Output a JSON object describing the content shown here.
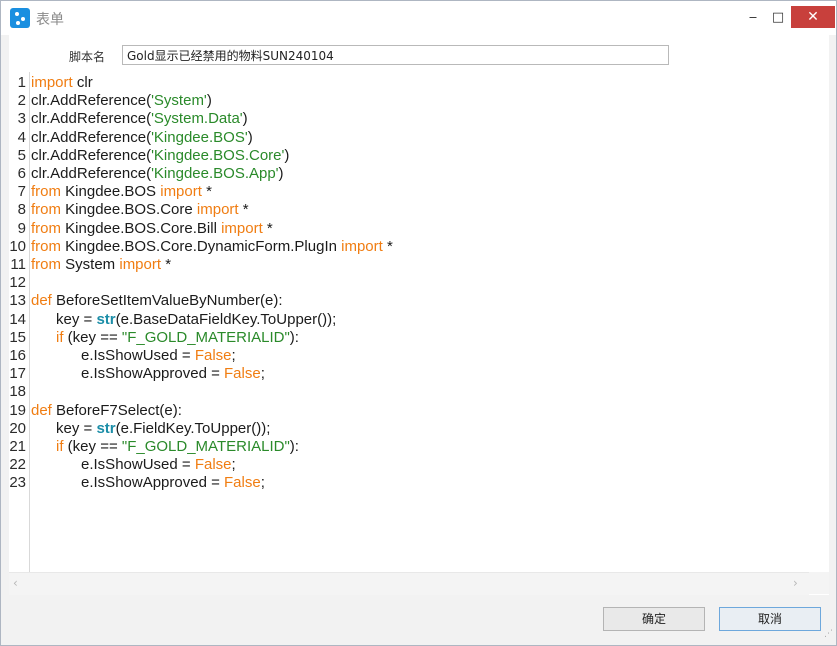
{
  "window": {
    "title": "表单",
    "minimize_icon": "minimize-icon",
    "maximize_icon": "maximize-icon",
    "close_icon": "close-icon"
  },
  "form": {
    "script_name_label": "脚本名",
    "script_name_value": "Gold显示已经禁用的物料SUN240104"
  },
  "editor": {
    "lines": [
      {
        "n": "1",
        "segs": [
          [
            "kw",
            "import"
          ],
          [
            "t",
            " clr"
          ]
        ]
      },
      {
        "n": "2",
        "segs": [
          [
            "t",
            "clr.AddReference("
          ],
          [
            "str",
            "'System'"
          ],
          [
            "t",
            ")"
          ]
        ]
      },
      {
        "n": "3",
        "segs": [
          [
            "t",
            "clr.AddReference("
          ],
          [
            "str",
            "'System.Data'"
          ],
          [
            "t",
            ")"
          ]
        ]
      },
      {
        "n": "4",
        "segs": [
          [
            "t",
            "clr.AddReference("
          ],
          [
            "str",
            "'Kingdee.BOS'"
          ],
          [
            "t",
            ")"
          ]
        ]
      },
      {
        "n": "5",
        "segs": [
          [
            "t",
            "clr.AddReference("
          ],
          [
            "str",
            "'Kingdee.BOS.Core'"
          ],
          [
            "t",
            ")"
          ]
        ]
      },
      {
        "n": "6",
        "segs": [
          [
            "t",
            "clr.AddReference("
          ],
          [
            "str",
            "'Kingdee.BOS.App'"
          ],
          [
            "t",
            ")"
          ]
        ]
      },
      {
        "n": "7",
        "segs": [
          [
            "kw",
            "from"
          ],
          [
            "t",
            " Kingdee.BOS "
          ],
          [
            "kw",
            "import"
          ],
          [
            "t",
            " *"
          ]
        ]
      },
      {
        "n": "8",
        "segs": [
          [
            "kw",
            "from"
          ],
          [
            "t",
            " Kingdee.BOS.Core "
          ],
          [
            "kw",
            "import"
          ],
          [
            "t",
            " *"
          ]
        ]
      },
      {
        "n": "9",
        "segs": [
          [
            "kw",
            "from"
          ],
          [
            "t",
            " Kingdee.BOS.Core.Bill "
          ],
          [
            "kw",
            "import"
          ],
          [
            "t",
            " *"
          ]
        ]
      },
      {
        "n": "10",
        "segs": [
          [
            "kw",
            "from"
          ],
          [
            "t",
            " Kingdee.BOS.Core.DynamicForm.PlugIn "
          ],
          [
            "kw",
            "import"
          ],
          [
            "t",
            " *"
          ]
        ]
      },
      {
        "n": "11",
        "segs": [
          [
            "kw",
            "from"
          ],
          [
            "t",
            " System "
          ],
          [
            "kw",
            "import"
          ],
          [
            "t",
            " *"
          ]
        ]
      },
      {
        "n": "12",
        "segs": []
      },
      {
        "n": "13",
        "segs": [
          [
            "kw",
            "def"
          ],
          [
            "t",
            " BeforeSetItemValueByNumber(e):"
          ]
        ]
      },
      {
        "n": "14",
        "segs": [
          [
            "t",
            "      key = "
          ],
          [
            "bi",
            "str"
          ],
          [
            "t",
            "(e.BaseDataFieldKey.ToUpper());"
          ]
        ]
      },
      {
        "n": "15",
        "segs": [
          [
            "t",
            "      "
          ],
          [
            "kw",
            "if"
          ],
          [
            "t",
            " (key == "
          ],
          [
            "str",
            "\"F_GOLD_MATERIALID\""
          ],
          [
            "t",
            "):"
          ]
        ]
      },
      {
        "n": "16",
        "segs": [
          [
            "t",
            "            e.IsShowUsed = "
          ],
          [
            "kw",
            "False"
          ],
          [
            "t",
            ";"
          ]
        ]
      },
      {
        "n": "17",
        "segs": [
          [
            "t",
            "            e.IsShowApproved = "
          ],
          [
            "kw",
            "False"
          ],
          [
            "t",
            ";"
          ]
        ]
      },
      {
        "n": "18",
        "segs": []
      },
      {
        "n": "19",
        "segs": [
          [
            "kw",
            "def"
          ],
          [
            "t",
            " BeforeF7Select(e):"
          ]
        ]
      },
      {
        "n": "20",
        "segs": [
          [
            "t",
            "      key = "
          ],
          [
            "bi",
            "str"
          ],
          [
            "t",
            "(e.FieldKey.ToUpper());"
          ]
        ]
      },
      {
        "n": "21",
        "segs": [
          [
            "t",
            "      "
          ],
          [
            "kw",
            "if"
          ],
          [
            "t",
            " (key == "
          ],
          [
            "str",
            "\"F_GOLD_MATERIALID\""
          ],
          [
            "t",
            "):"
          ]
        ]
      },
      {
        "n": "22",
        "segs": [
          [
            "t",
            "            e.IsShowUsed = "
          ],
          [
            "kw",
            "False"
          ],
          [
            "t",
            ";"
          ]
        ]
      },
      {
        "n": "23",
        "segs": [
          [
            "t",
            "            e.IsShowApproved = "
          ],
          [
            "kw",
            "False"
          ],
          [
            "t",
            ";"
          ]
        ]
      }
    ]
  },
  "buttons": {
    "ok_label": "确定",
    "cancel_label": "取消"
  },
  "colors": {
    "keyword": "#f07d12",
    "string": "#2a8a2a",
    "builtin": "#1c8ea8",
    "close_button": "#c8403c"
  }
}
